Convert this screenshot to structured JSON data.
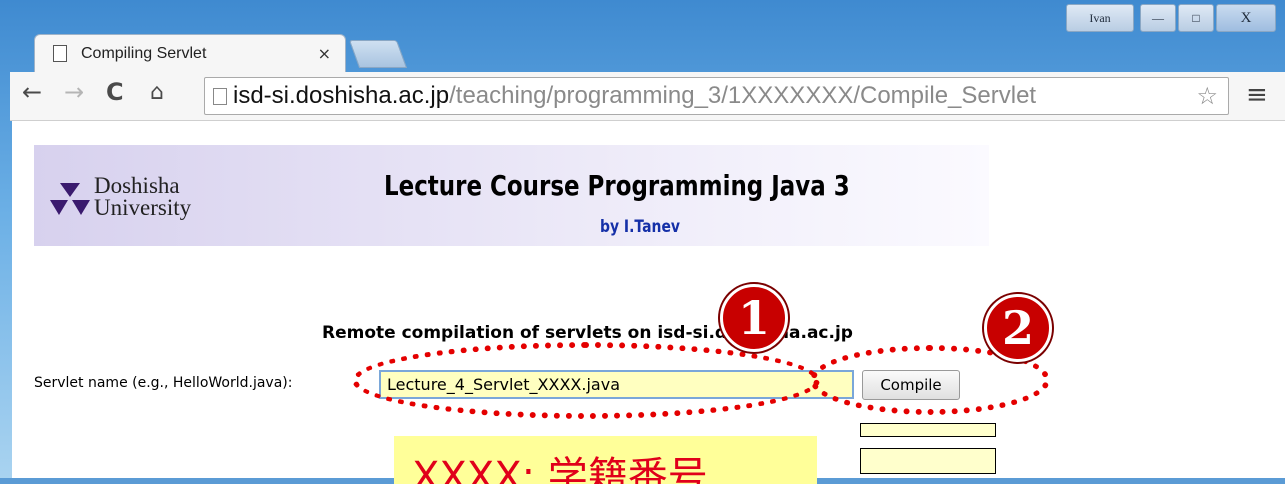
{
  "window": {
    "user": "Ivan",
    "minimize_glyph": "—",
    "maximize_glyph": "□",
    "close_glyph": "X"
  },
  "tab": {
    "title": "Compiling Servlet",
    "close_glyph": "×"
  },
  "nav": {
    "back": "←",
    "forward": "→",
    "reload": "C",
    "home": "⌂",
    "menu": "≡",
    "star": "☆"
  },
  "address": {
    "host": "isd-si.doshisha.ac.jp",
    "path": "/teaching/programming_3/1XXXXXXX/Compile_Servlet"
  },
  "banner": {
    "logo_line1": "Doshisha",
    "logo_line2": "University",
    "title": "Lecture Course Programming Java 3",
    "byline": "by I.Tanev"
  },
  "form": {
    "heading": "Remote compilation of servlets on isd-si.doshisha.ac.jp",
    "label": "Servlet name (e.g., HelloWorld.java):",
    "input_value": "Lecture_4_Servlet_XXXX.java",
    "button": "Compile"
  },
  "annotations": {
    "badge1": "1",
    "badge2": "2",
    "note": "XXXX: 学籍番号",
    "ring_color": "#e40000"
  }
}
